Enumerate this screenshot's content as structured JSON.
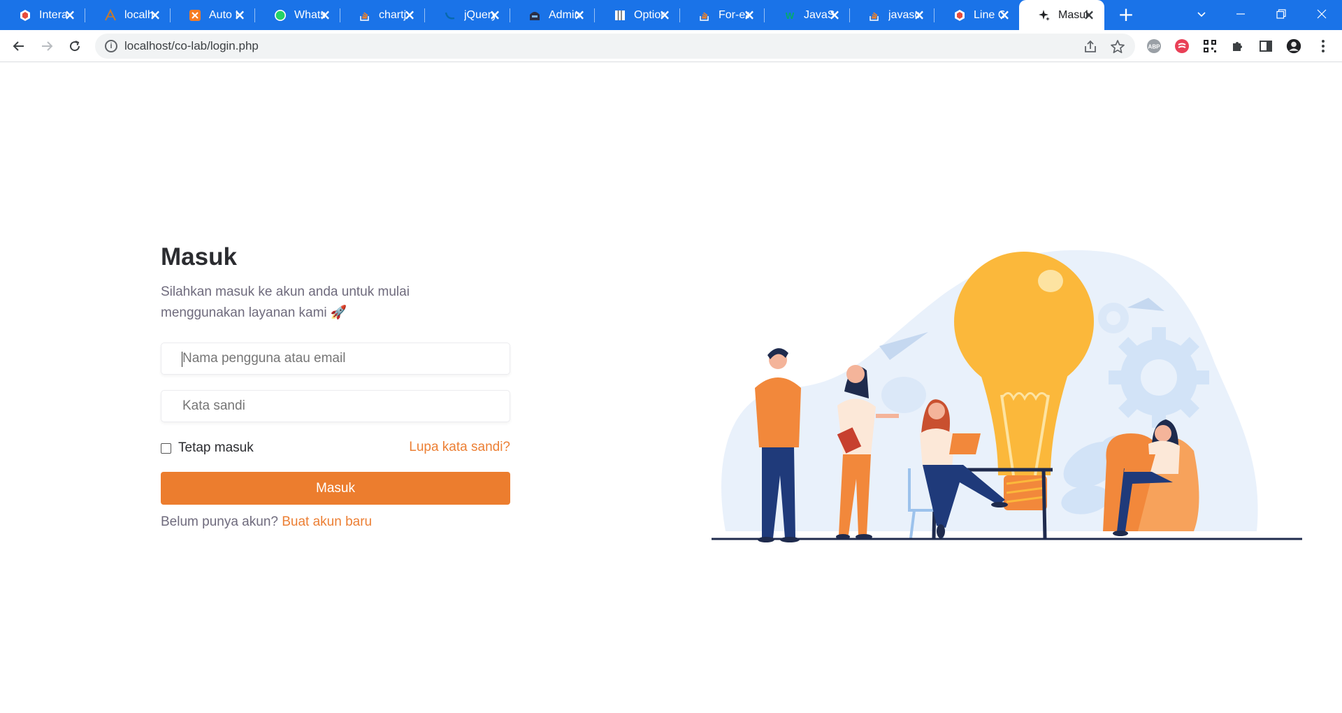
{
  "tabs": [
    {
      "title": "Intera",
      "icon": "laravel-cube-icon",
      "color": "#e74c3c"
    },
    {
      "title": "localh",
      "icon": "localhost-arch-icon",
      "color": "#c87a2a"
    },
    {
      "title": "Auto I",
      "icon": "xampp-icon",
      "color": "#f57c24"
    },
    {
      "title": "Whats",
      "icon": "whatsapp-icon",
      "color": "#25d366"
    },
    {
      "title": "chartj",
      "icon": "stackoverflow-icon",
      "color": "#f48024"
    },
    {
      "title": "jQuery",
      "icon": "jquery-icon",
      "color": "#0769ad"
    },
    {
      "title": "Admin",
      "icon": "admin-mask-icon",
      "color": "#2b2f45"
    },
    {
      "title": "Option",
      "icon": "book-icon",
      "color": "#ffffff"
    },
    {
      "title": "For-ea",
      "icon": "stackoverflow-icon",
      "color": "#f48024"
    },
    {
      "title": "JavaSc",
      "icon": "w3schools-icon",
      "color": "#04aa6d"
    },
    {
      "title": "javasc",
      "icon": "stackoverflow-icon",
      "color": "#f48024"
    },
    {
      "title": "Line C",
      "icon": "laravel-cube-icon",
      "color": "#e74c3c"
    },
    {
      "title": "Masuk",
      "icon": "sparkle-icon",
      "color": "#202124"
    }
  ],
  "active_tab_index": 12,
  "address_bar": {
    "url": "localhost/co-lab/login.php"
  },
  "extensions": [
    "abp-icon",
    "ext-red-icon",
    "qr-icon",
    "puzzle-icon",
    "sidepanel-icon",
    "profile-avatar-icon"
  ],
  "login": {
    "title": "Masuk",
    "subtitle": "Silahkan masuk ke akun anda untuk mulai menggunakan layanan kami 🚀",
    "username_placeholder": "Nama pengguna atau email",
    "password_placeholder": "Kata sandi",
    "remember_label": "Tetap masuk",
    "forgot_label": "Lupa kata sandi?",
    "submit_label": "Masuk",
    "no_account_text": "Belum punya akun?",
    "create_account_label": "Buat akun baru"
  },
  "colors": {
    "accent": "#ec7d2e",
    "tabstrip": "#1a73e8",
    "text_dark": "#2b2c30",
    "text_muted": "#6f6b7d"
  }
}
